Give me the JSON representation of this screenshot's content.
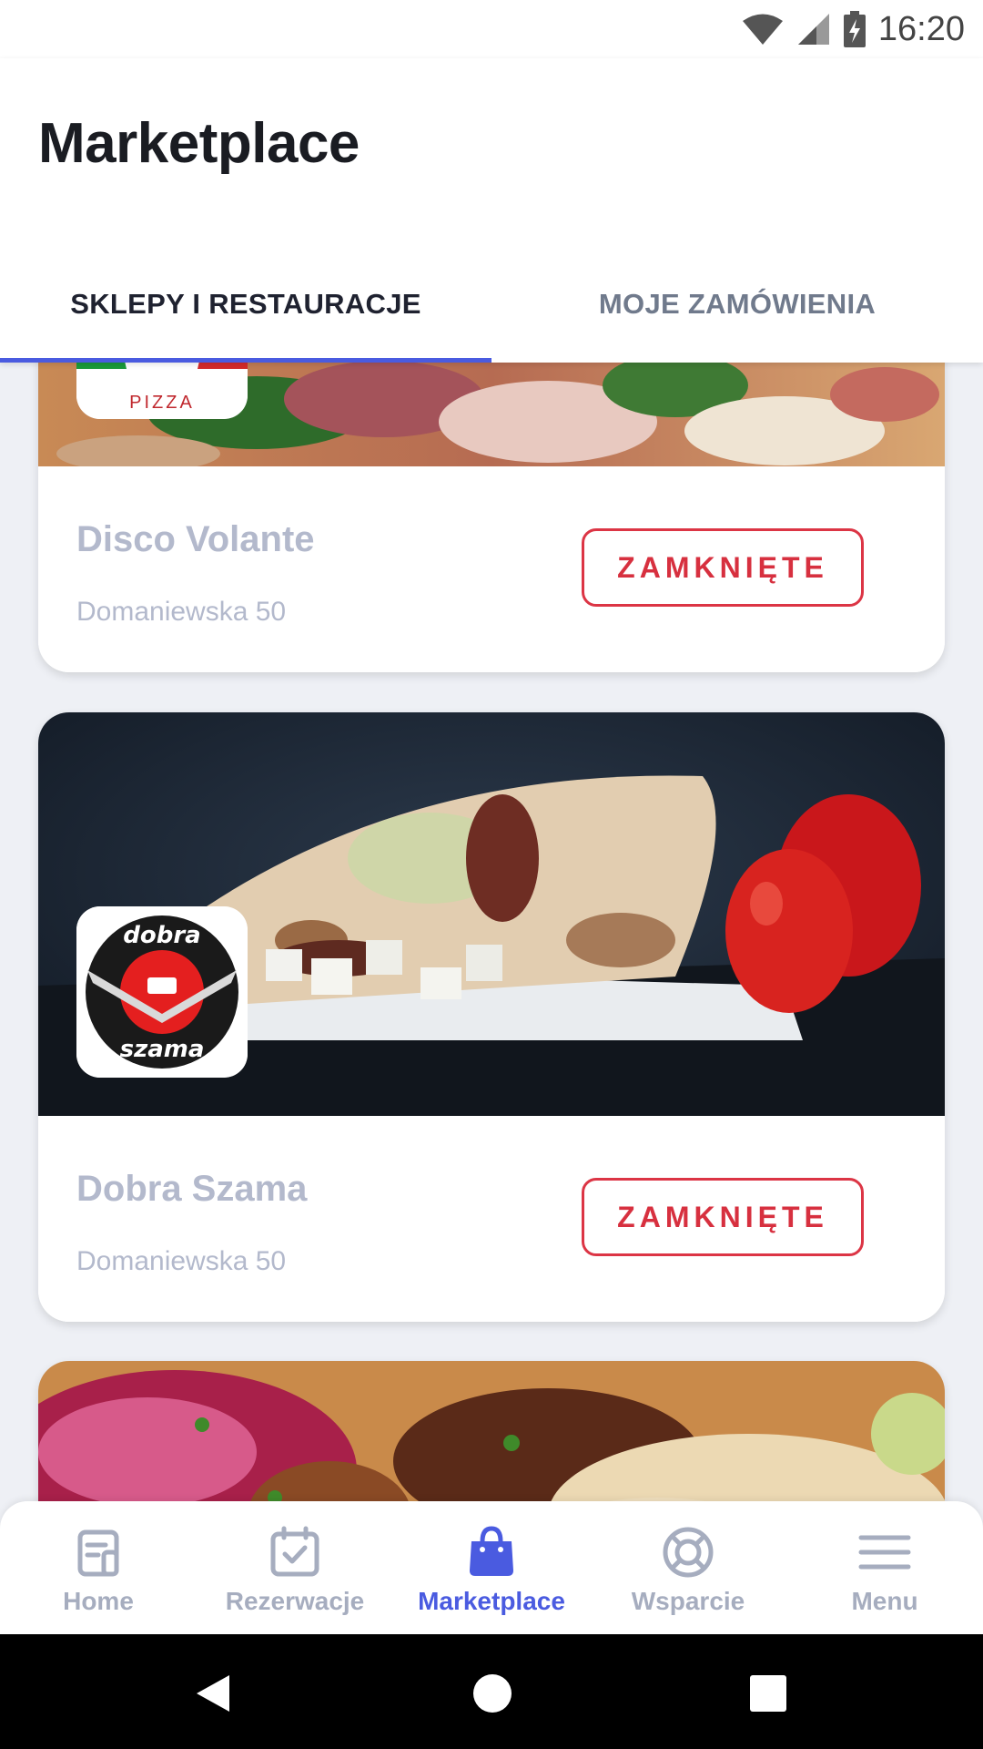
{
  "status_bar": {
    "time": "16:20"
  },
  "header": {
    "title": "Marketplace",
    "tabs": [
      {
        "label": "SKLEPY I RESTAURACJE",
        "active": true
      },
      {
        "label": "MOJE ZAMÓWIENIA",
        "active": false
      }
    ]
  },
  "shops": [
    {
      "name": "Disco Volante",
      "address": "Domaniewska 50",
      "status": "ZAMKNIĘTE",
      "logo_text": "PIZZA"
    },
    {
      "name": "Dobra Szama",
      "address": "Domaniewska 50",
      "status": "ZAMKNIĘTE",
      "logo_text_top": "dobra",
      "logo_text_bottom": "szama"
    }
  ],
  "bottom_nav": [
    {
      "label": "Home",
      "icon": "home-icon"
    },
    {
      "label": "Rezerwacje",
      "icon": "calendar-check-icon"
    },
    {
      "label": "Marketplace",
      "icon": "shopping-bag-icon",
      "active": true
    },
    {
      "label": "Wsparcie",
      "icon": "lifebuoy-icon"
    },
    {
      "label": "Menu",
      "icon": "hamburger-menu-icon"
    }
  ],
  "colors": {
    "accent": "#4a5be0",
    "closed_red": "#d7303f",
    "muted_text": "#b3b9cc",
    "background": "#eef0f5"
  }
}
